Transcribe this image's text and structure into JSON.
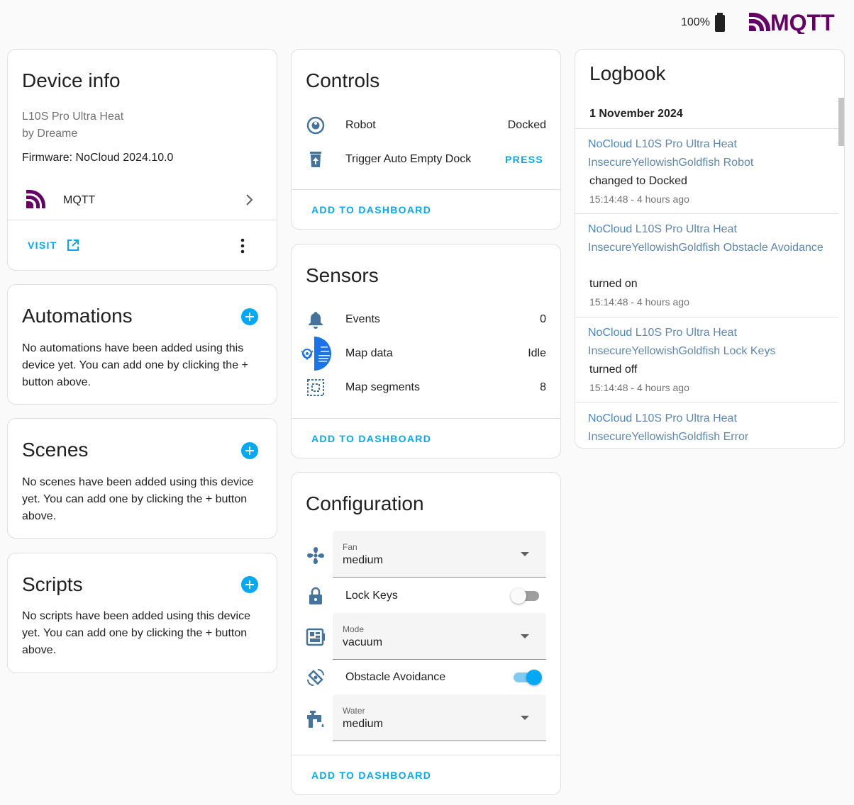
{
  "topbar": {
    "battery": "100%",
    "brand": "MQTT"
  },
  "device_info": {
    "title": "Device info",
    "model": "L10S Pro Ultra Heat",
    "manufacturer": "by Dreame",
    "firmware": "Firmware: NoCloud 2024.10.0",
    "integration": "MQTT",
    "visit": "VISIT"
  },
  "automations": {
    "title": "Automations",
    "text": "No automations have been added using this device yet. You can add one by clicking the + button above."
  },
  "scenes": {
    "title": "Scenes",
    "text": "No scenes have been added using this device yet. You can add one by clicking the + button above."
  },
  "scripts": {
    "title": "Scripts",
    "text": "No scripts have been added using this device yet. You can add one by clicking the + button above."
  },
  "controls": {
    "title": "Controls",
    "items": [
      {
        "label": "Robot",
        "value": "Docked",
        "icon": "robot-vacuum-icon"
      },
      {
        "label": "Trigger Auto Empty Dock",
        "value": "PRESS",
        "icon": "trash-upload-icon"
      }
    ],
    "action": "ADD TO DASHBOARD"
  },
  "sensors": {
    "title": "Sensors",
    "items": [
      {
        "label": "Events",
        "value": "0",
        "icon": "bell-icon"
      },
      {
        "label": "Map data",
        "value": "Idle",
        "icon": "map-thumbnail-icon"
      },
      {
        "label": "Map segments",
        "value": "8",
        "icon": "segments-icon"
      }
    ],
    "action": "ADD TO DASHBOARD"
  },
  "configuration": {
    "title": "Configuration",
    "fan": {
      "label": "Fan",
      "value": "medium"
    },
    "lock_keys": {
      "label": "Lock Keys",
      "on": false
    },
    "mode": {
      "label": "Mode",
      "value": "vacuum"
    },
    "obstacle": {
      "label": "Obstacle Avoidance",
      "on": true
    },
    "water": {
      "label": "Water",
      "value": "medium"
    },
    "action": "ADD TO DASHBOARD"
  },
  "logbook": {
    "title": "Logbook",
    "date": "1 November 2024",
    "entries": [
      {
        "prefix": "NoCloud",
        "name": " L10S Pro Ultra Heat InsecureYellowishGoldfish Robot",
        "msg": "changed to Docked",
        "time": "15:14:48 - 4 hours ago"
      },
      {
        "prefix": "NoCloud",
        "name": " L10S Pro Ultra Heat InsecureYellowishGoldfish Obstacle Avoidance",
        "msg": "turned on",
        "time": "15:14:48 - 4 hours ago"
      },
      {
        "prefix": "NoCloud",
        "name": " L10S Pro Ultra Heat InsecureYellowishGoldfish Lock Keys",
        "msg": "turned off",
        "time": "15:14:48 - 4 hours ago"
      },
      {
        "prefix": "NoCloud",
        "name": " L10S Pro Ultra Heat InsecureYellowishGoldfish Error",
        "msg": "",
        "time": ""
      }
    ]
  },
  "colors": {
    "accent": "#03a9f4",
    "icon": "#44739e",
    "mqtt": "#660066",
    "link": "#4a86c5"
  }
}
